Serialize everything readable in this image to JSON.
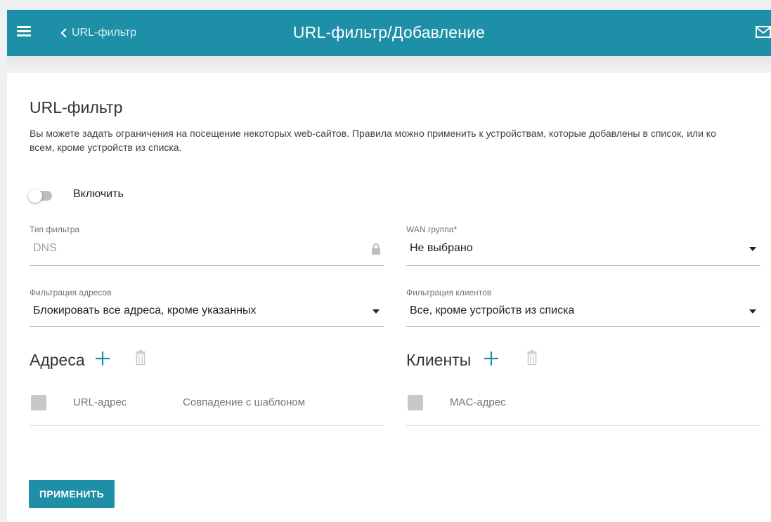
{
  "header": {
    "back_label": "URL-фильтр",
    "title": "URL-фильтр/Добавление",
    "menu_icon": "menu-icon",
    "back_icon": "chevron-left-icon",
    "mail_icon": "mail-icon",
    "accent_color": "#1d8fa7"
  },
  "section": {
    "title": "URL-фильтр",
    "description": "Вы можете задать ограничения на посещение некоторых web-сайтов. Правила можно применить к устройствам, которые добавлены в список, или ко всем, кроме устройств из списка."
  },
  "enable_toggle": {
    "label": "Включить",
    "checked": false
  },
  "fields": {
    "filter_type": {
      "label": "Тип фильтра",
      "value": "DNS",
      "locked": true
    },
    "wan_group": {
      "label": "WAN группа",
      "required_mark": "*",
      "value": "Не выбрано"
    },
    "address_filtering": {
      "label": "Фильтрация адресов",
      "value": "Блокировать все адреса, кроме указанных"
    },
    "client_filtering": {
      "label": "Фильтрация клиентов",
      "value": "Все, кроме устройств из списка"
    }
  },
  "addresses": {
    "title": "Адреса",
    "columns": [
      "URL-адрес",
      "Совпадение с шаблоном"
    ]
  },
  "clients": {
    "title": "Клиенты",
    "columns": [
      "MAC-адрес"
    ]
  },
  "apply_button": "ПРИМЕНИТЬ"
}
